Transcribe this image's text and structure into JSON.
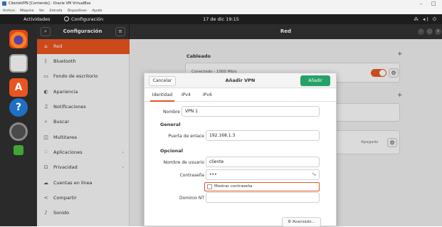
{
  "vbox": {
    "title": "ClienteVPN [Corriendo] - Oracle VM VirtualBox",
    "menu": [
      "Archivo",
      "Máquina",
      "Ver",
      "Entrada",
      "Dispositivos",
      "Ayuda"
    ],
    "minimize": "–",
    "close": "□"
  },
  "topbar": {
    "activities": "Actividades",
    "app_name": "Configuración",
    "clock": "17 de dic  19:15",
    "tray": "⁂ ◂) ⏻"
  },
  "settings": {
    "sidebar_title": "Configuración",
    "search_glyph": "⌕",
    "menu_glyph": "≡",
    "main_title": "Red",
    "window_controls": [
      "–",
      "□",
      "×"
    ],
    "nav": [
      {
        "icon": "⌂",
        "label": "Red",
        "active": true,
        "chevron": ""
      },
      {
        "icon": "ᛒ",
        "label": "Bluetooth",
        "active": false,
        "chevron": ""
      },
      {
        "icon": "▭",
        "label": "Fondo de escritorio",
        "active": false,
        "chevron": ""
      },
      {
        "icon": "◐",
        "label": "Apariencia",
        "active": false,
        "chevron": ""
      },
      {
        "icon": "♫",
        "label": "Notificaciones",
        "active": false,
        "chevron": ""
      },
      {
        "icon": "⌕",
        "label": "Buscar",
        "active": false,
        "chevron": ""
      },
      {
        "icon": "◫",
        "label": "Multitarea",
        "active": false,
        "chevron": ""
      },
      {
        "icon": "⁙",
        "label": "Aplicaciones",
        "active": false,
        "chevron": "›"
      },
      {
        "icon": "⊡",
        "label": "Privacidad",
        "active": false,
        "chevron": "›"
      },
      {
        "icon": "☁",
        "label": "Cuentas en línea",
        "active": false,
        "chevron": ""
      },
      {
        "icon": "<",
        "label": "Compartir",
        "active": false,
        "chevron": ""
      },
      {
        "icon": "♪",
        "label": "Sonido",
        "active": false,
        "chevron": ""
      }
    ],
    "content": {
      "wired_title": "Cableado",
      "wired_status": "Conectado - 1000 Mb/s",
      "plus": "+",
      "vpn_status": "Apagado",
      "cog": "⚙"
    }
  },
  "dialog": {
    "cancel": "Cancelar",
    "title": "Añadir VPN",
    "add": "Añadir",
    "tabs": [
      "Identidad",
      "IPv4",
      "IPv6"
    ],
    "name_label": "Nombre",
    "name_value": "VPN 1",
    "general": "General",
    "gateway_label": "Puerta de enlace",
    "gateway_value": "192.168.1.3",
    "optional": "Opcional",
    "user_label": "Nombre de usuario",
    "user_value": "cliente",
    "password_label": "Contraseña",
    "password_value": "•••",
    "password_icon": "ᵃ⁎",
    "show_password": "Mostrar contraseña",
    "nt_label": "Dominio NT",
    "nt_value": "",
    "advanced": "Avanzado..."
  }
}
